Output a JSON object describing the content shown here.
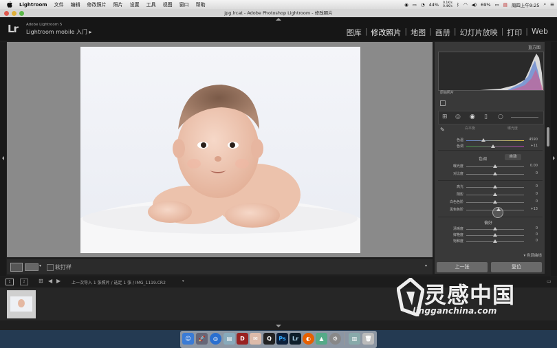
{
  "menubar": {
    "app": "Lightroom",
    "items": [
      "文件",
      "编辑",
      "修改照片",
      "照片",
      "设置",
      "工具",
      "视图",
      "窗口",
      "帮助"
    ],
    "battery_pct": "44%",
    "net_up": "0.1K/s",
    "net_down": "0.4K/s",
    "battery2": "69%",
    "datetime": "周四上午9:25"
  },
  "window": {
    "title": "jpg.lrcat - Adobe Photoshop Lightroom - 修改照片"
  },
  "identity": {
    "logo": "Lr",
    "product": "Adobe Lightroom 5",
    "mobile": "Lightroom mobile 入门"
  },
  "modules": [
    "图库",
    "修改照片",
    "地图",
    "画册",
    "幻灯片放映",
    "打印",
    "Web"
  ],
  "active_module": "修改照片",
  "toolbar": {
    "softproof": "软打样"
  },
  "panel": {
    "histogram_title": "直方图",
    "histogram_info": "原始照片",
    "tone_title": "色调",
    "tone_auto": "自动",
    "presence_title": "偏好",
    "tabs": [
      "白平衡",
      "曝光度"
    ],
    "sliders": [
      {
        "label": "色温",
        "value": "4590",
        "pos": 0.3
      },
      {
        "label": "色调",
        "value": "+11",
        "pos": 0.47
      },
      {
        "label": "曝光度",
        "value": "0.00",
        "pos": 0.5
      },
      {
        "label": "对比度",
        "value": "0",
        "pos": 0.5
      },
      {
        "label": "高光",
        "value": "0",
        "pos": 0.5
      },
      {
        "label": "阴影",
        "value": "0",
        "pos": 0.5
      },
      {
        "label": "白色色阶",
        "value": "0",
        "pos": 0.5
      },
      {
        "label": "黑色色阶",
        "value": "+13",
        "pos": 0.56
      },
      {
        "label": "清晰度",
        "value": "0",
        "pos": 0.5
      },
      {
        "label": "鲜艳度",
        "value": "0",
        "pos": 0.5
      },
      {
        "label": "饱和度",
        "value": "0",
        "pos": 0.5
      }
    ],
    "next_section": "色调曲线",
    "prev_button": "上一张",
    "reset_button": "复位"
  },
  "filmstrip": {
    "page1": "1",
    "page2": "2",
    "path": "上一次导入  1 张照片 / 选定 1 张 / IMG_1119.CR2"
  },
  "watermark": {
    "cn": "灵感中国",
    "url": "lingganchina.com"
  },
  "dock": [
    "Finder",
    "Launchpad",
    "Safari",
    "Preview",
    "Diablo",
    "Mail",
    "QQ",
    "Ps",
    "Lr",
    "Firefox",
    "Photos",
    "Settings",
    "Downloads",
    "Trash"
  ]
}
